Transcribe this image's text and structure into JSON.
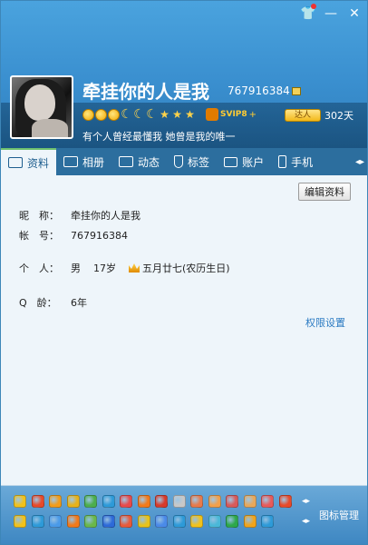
{
  "window": {
    "controls": [
      "skin-icon",
      "minimize-icon",
      "close-icon"
    ]
  },
  "profile": {
    "nickname": "牵挂你的人是我",
    "qq": "767916384",
    "level_icons": [
      "sun",
      "sun",
      "sun",
      "moon",
      "moon",
      "moon",
      "star",
      "star",
      "star"
    ],
    "svip": "SVIP8",
    "svip_plus": "+",
    "talent": "达人",
    "days": "302天",
    "signature": "有个人曾经最懂我 她曾是我的唯一"
  },
  "tabs": [
    {
      "label": "资料",
      "icon": "id-card-icon"
    },
    {
      "label": "相册",
      "icon": "photo-album-icon"
    },
    {
      "label": "动态",
      "icon": "feed-icon"
    },
    {
      "label": "标签",
      "icon": "tag-icon"
    },
    {
      "label": "账户",
      "icon": "wallet-icon"
    },
    {
      "label": "手机",
      "icon": "phone-icon"
    }
  ],
  "content": {
    "edit_label": "编辑资料",
    "nickname_label": "昵　称：",
    "nickname_value": "牵挂你的人是我",
    "account_label": "帐　号：",
    "account_value": "767916384",
    "personal_label": "个　人：",
    "gender": "男",
    "age": "17岁",
    "birthday": "五月廿七(农历生日)",
    "qage_label": "Q　龄：",
    "qage_value": "6年",
    "permission_link": "权限设置"
  },
  "footer": {
    "icon_manage": "图标管理",
    "app_colors": [
      "#f2c21a",
      "#e84a2a",
      "#f29c1a",
      "#e8b21a",
      "#4cae4c",
      "#2d9ad8",
      "#e84a4a",
      "#f27a1a",
      "#d83a2a",
      "#c8c8c8",
      "#e87a4a",
      "#f2a04a",
      "#d85a5a",
      "#e8a85a",
      "#e85a5a",
      "#e84a2a",
      "#f2c21a",
      "#2d9ad8",
      "#4a9ae8",
      "#f27a1a",
      "#6ab84a",
      "#2d6ad8",
      "#e85a3a",
      "#e8c21a",
      "#4a8ae8",
      "#2d9ad8",
      "#f2c21a",
      "#4ab8d8",
      "#2da84a",
      "#f2a41a",
      "#2d9ad8"
    ]
  }
}
